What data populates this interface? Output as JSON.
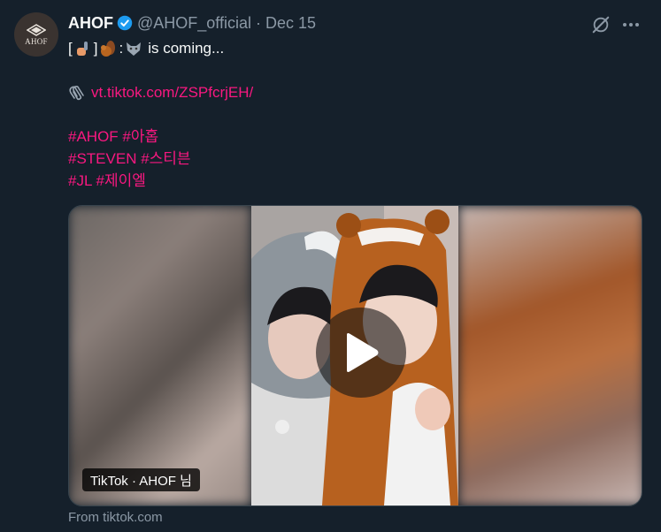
{
  "author": {
    "name": "AHOF",
    "handle": "@AHOF_official",
    "separator": "·",
    "date": "Dec 15",
    "avatar_text": "AHOF"
  },
  "tweet": {
    "line1_open": "[",
    "line1_close": "]",
    "line1_colon": ":",
    "line1_tail": "is coming...",
    "link": "vt.tiktok.com/ZSPfcrjEH/",
    "hashtags_line1": "#AHOF #아홉",
    "hashtags_line2": "#STEVEN #스티븐",
    "hashtags_line3": "#JL #제이엘"
  },
  "media": {
    "badge": "TikTok · AHOF 님"
  },
  "source": "From tiktok.com",
  "icons": [
    "verified-badge-icon",
    "grok-icon",
    "more-icon",
    "microphone-emoji",
    "chipmunk-emoji",
    "wolf-emoji",
    "paperclip-icon",
    "play-icon"
  ],
  "colors": {
    "background": "#15202b",
    "link": "#f91880",
    "muted": "#8b98a5",
    "verified": "#1d9bf0"
  }
}
